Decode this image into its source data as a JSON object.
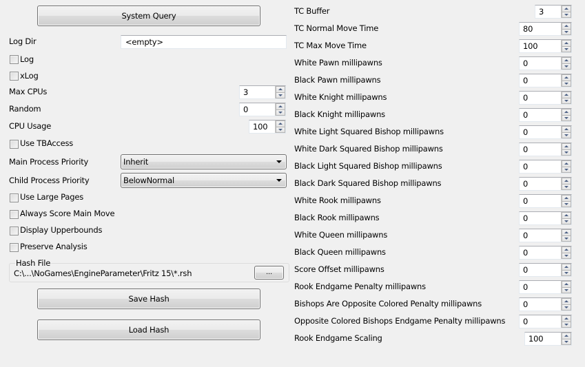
{
  "left": {
    "system_query_button": "System Query",
    "log_dir": {
      "label": "Log Dir",
      "value": "<empty>"
    },
    "log_checkbox": {
      "label": "Log",
      "checked": false
    },
    "xlog_checkbox": {
      "label": "xLog",
      "checked": false
    },
    "max_cpus": {
      "label": "Max CPUs",
      "value": "3"
    },
    "random": {
      "label": "Random",
      "value": "0"
    },
    "cpu_usage": {
      "label": "CPU Usage",
      "value": "100"
    },
    "use_tbaccess": {
      "label": "Use TBAccess",
      "checked": false
    },
    "main_priority": {
      "label": "Main Process Priority",
      "value": "Inherit"
    },
    "child_priority": {
      "label": "Child Process Priority",
      "value": "BelowNormal"
    },
    "use_large_pages": {
      "label": "Use Large Pages",
      "checked": false
    },
    "always_score_main_move": {
      "label": "Always Score Main Move",
      "checked": false
    },
    "display_upperbounds": {
      "label": "Display Upperbounds",
      "checked": false
    },
    "preserve_analysis": {
      "label": "Preserve Analysis",
      "checked": false
    },
    "hash_file": {
      "title": "Hash File",
      "path": "C:\\...\\NoGames\\EngineParameter\\Fritz 15\\*.rsh",
      "browse_label": "..."
    },
    "save_hash_button": "Save Hash",
    "load_hash_button": "Load Hash"
  },
  "right": {
    "params": [
      {
        "label": "TC Buffer",
        "value": "3"
      },
      {
        "label": "TC Normal Move Time",
        "value": "80"
      },
      {
        "label": "TC Max Move Time",
        "value": "100"
      },
      {
        "label": "White Pawn millipawns",
        "value": "0"
      },
      {
        "label": "Black Pawn millipawns",
        "value": "0"
      },
      {
        "label": "White Knight millipawns",
        "value": "0"
      },
      {
        "label": "Black Knight millipawns",
        "value": "0"
      },
      {
        "label": "White Light Squared Bishop millipawns",
        "value": "0"
      },
      {
        "label": "White Dark Squared Bishop millipawns",
        "value": "0"
      },
      {
        "label": "Black Light Squared Bishop millipawns",
        "value": "0"
      },
      {
        "label": "Black Dark Squared Bishop millipawns",
        "value": "0"
      },
      {
        "label": "White Rook millipawns",
        "value": "0"
      },
      {
        "label": "Black Rook millipawns",
        "value": "0"
      },
      {
        "label": "White Queen millipawns",
        "value": "0"
      },
      {
        "label": "Black Queen millipawns",
        "value": "0"
      },
      {
        "label": "Score Offset millipawns",
        "value": "0"
      },
      {
        "label": "Rook Endgame Penalty millipawns",
        "value": "0"
      },
      {
        "label": "Bishops Are Opposite Colored Penalty millipawns",
        "value": "0"
      },
      {
        "label": "Opposite Colored Bishops Endgame Penalty millipawns",
        "value": "0"
      },
      {
        "label": "Rook Endgame Scaling",
        "value": "100"
      }
    ]
  }
}
